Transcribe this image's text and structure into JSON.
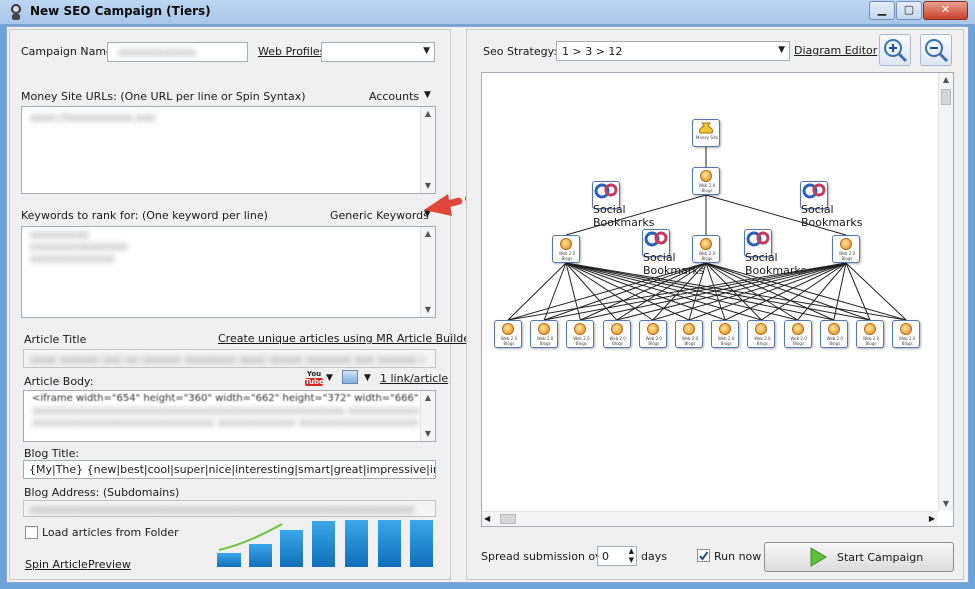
{
  "window": {
    "title": "New SEO Campaign (Tiers)",
    "minimize": "▁",
    "maximize": "▢",
    "close": "✕"
  },
  "campaign": {
    "name_label": "Campaign Name:",
    "web_profiles_link": "Web Profiles"
  },
  "money_site": {
    "label": "Money Site URLs: (One URL per line or Spin Syntax)",
    "accounts": "Accounts"
  },
  "keywords": {
    "label": "Keywords to rank for: (One keyword per line)",
    "generic": "Generic Keywords"
  },
  "article": {
    "title_label": "Article Title",
    "builder_link": "Create unique articles using MR Article Builder",
    "body_label": "Article Body:",
    "youtube_top": "You",
    "youtube_bottom": "Tube",
    "link_per_article": "1 link/article",
    "body_value": "<iframe width=\"654\" height=\"360\" width=\"662\" height=\"372\" width=\"666\""
  },
  "blog": {
    "title_label": "Blog Title:",
    "title_value": "{My|The} {new|best|cool|super|nice|interesting|smart|great|impressive|inspiring|spl",
    "address_label": "Blog Address: (Subdomains)"
  },
  "options": {
    "load_folder": "Load articles from Folder",
    "spin_article": "Spin Article",
    "preview": "Preview"
  },
  "strategy": {
    "label": "Seo Strategy:",
    "value": "1 > 3 > 12",
    "diagram_editor": "Diagram Editor"
  },
  "diagram": {
    "money_caption": "Money Site",
    "web20_caption": "Web 2.0 Blogs",
    "social_caption": "Social Bookmarks"
  },
  "footer": {
    "spread_label": "Spread submission over",
    "spread_value": "0",
    "days": "days",
    "run_now": "Run now",
    "start": "Start Campaign"
  },
  "colors": {
    "title_bar": "#a9c7ea",
    "accent_arrow": "#e0473a",
    "bars": "#1c8bd6"
  }
}
